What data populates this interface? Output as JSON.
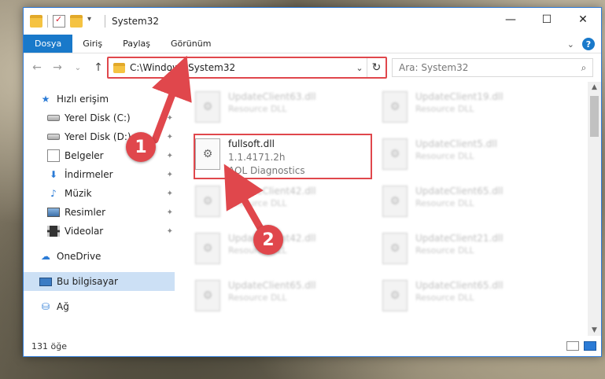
{
  "window": {
    "title": "System32",
    "controls": {
      "minimize": "—",
      "maximize": "☐",
      "close": "✕"
    }
  },
  "ribbon": {
    "tabs": [
      "Dosya",
      "Giriş",
      "Paylaş",
      "Görünüm"
    ]
  },
  "nav": {
    "back": "←",
    "forward": "→",
    "recent": "⌄",
    "up": "↑",
    "address": "C:\\Windows\\System32",
    "dropdown": "⌄",
    "refresh": "↻",
    "search_placeholder": "Ara: System32",
    "search_icon": "⌕"
  },
  "sidebar": {
    "items": [
      {
        "label": "Hızlı erişim",
        "icon": "star-icon",
        "glyph": "★"
      },
      {
        "label": "Yerel Disk (C:)",
        "icon": "drive-icon",
        "pinned": true
      },
      {
        "label": "Yerel Disk (D:)",
        "icon": "drive-icon",
        "pinned": true
      },
      {
        "label": "Belgeler",
        "icon": "documents-icon",
        "pinned": true
      },
      {
        "label": "İndirmeler",
        "icon": "download-icon",
        "glyph": "⬇",
        "pinned": true
      },
      {
        "label": "Müzik",
        "icon": "music-icon",
        "glyph": "♪",
        "pinned": true
      },
      {
        "label": "Resimler",
        "icon": "pictures-icon",
        "pinned": true
      },
      {
        "label": "Videolar",
        "icon": "videos-icon",
        "pinned": true
      },
      {
        "label": "OneDrive",
        "icon": "cloud-icon",
        "glyph": "☁"
      },
      {
        "label": "Bu bilgisayar",
        "icon": "computer-icon",
        "selected": true
      },
      {
        "label": "Ağ",
        "icon": "network-icon",
        "glyph": "⛁"
      }
    ],
    "pin_glyph": "📌"
  },
  "files": [
    {
      "name": "UpdateClient63.dll",
      "type": "Resource DLL",
      "blurred": true
    },
    {
      "name": "UpdateClient19.dll",
      "type": "Resource DLL",
      "blurred": true
    },
    {
      "name": "fullsoft.dll",
      "version": "1.1.4171.2h",
      "company": "AOL Diagnostics",
      "blurred": false
    },
    {
      "name": "UpdateClient5.dll",
      "type": "Resource DLL",
      "blurred": true
    },
    {
      "name": "UpdateClient42.dll",
      "type": "Resource DLL",
      "blurred": true
    },
    {
      "name": "UpdateClient65.dll",
      "type": "Resource DLL",
      "blurred": true
    },
    {
      "name": "UpdateClient42.dll",
      "type": "Resource DLL",
      "blurred": true
    },
    {
      "name": "UpdateClient21.dll",
      "type": "Resource DLL",
      "blurred": true
    },
    {
      "name": "UpdateClient65.dll",
      "type": "Resource DLL",
      "blurred": true
    },
    {
      "name": "UpdateClient65.dll",
      "type": "Resource DLL",
      "blurred": true
    }
  ],
  "status": {
    "count": "131 öğe"
  },
  "annotations": {
    "step1": "1",
    "step2": "2",
    "color": "#e0474c"
  }
}
